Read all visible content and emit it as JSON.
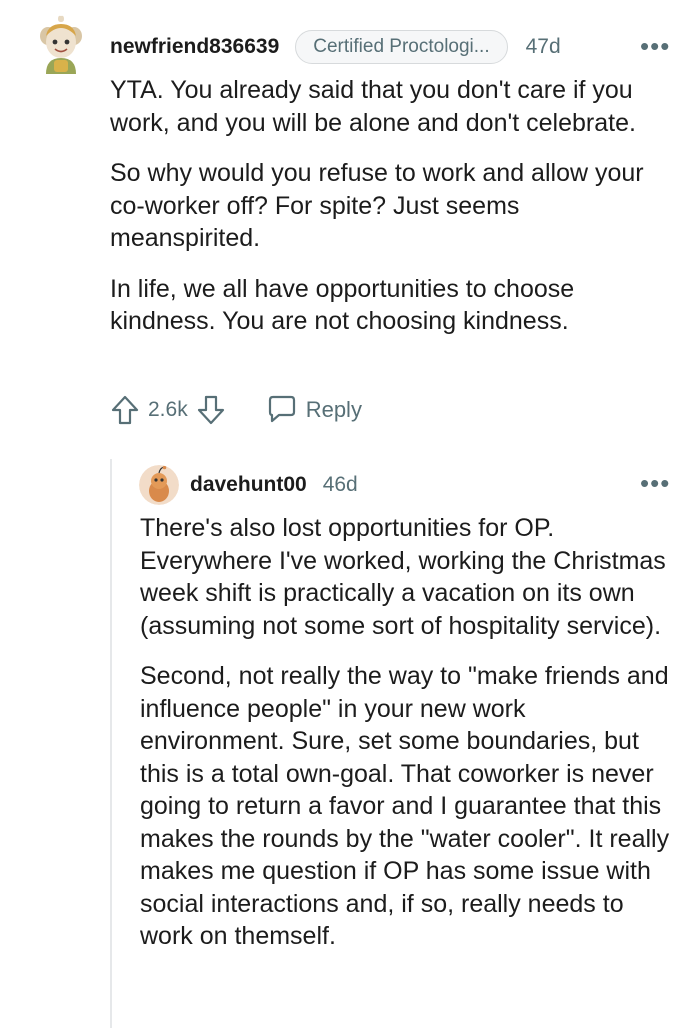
{
  "comment": {
    "username": "newfriend836639",
    "flair": "Certified Proctologi...",
    "age": "47d",
    "more": "•••",
    "paragraphs": [
      "YTA. You already said that you don't care if you work, and you will be alone and don't celebrate.",
      "So why would you refuse to work and allow your co-worker off? For spite? Just seems meanspirited.",
      "In life, we all have opportunities to choose kindness. You are not choosing kindness."
    ],
    "score": "2.6k",
    "reply_label": "Reply"
  },
  "reply": {
    "username": "davehunt00",
    "age": "46d",
    "more": "•••",
    "paragraphs": [
      "There's also lost opportunities for OP. Everywhere I've worked, working the Christmas week shift is practically a vacation on its own (assuming not some sort of hospitality service).",
      "Second, not really the way to \"make friends and influence people\" in your new work environment. Sure, set some boundaries, but this is a total own-goal. That coworker is never going to return a favor and I guarantee that this makes the rounds by the \"water cooler\". It really makes me question if OP has some issue with social interactions and, if so, really needs to work on themself."
    ]
  }
}
